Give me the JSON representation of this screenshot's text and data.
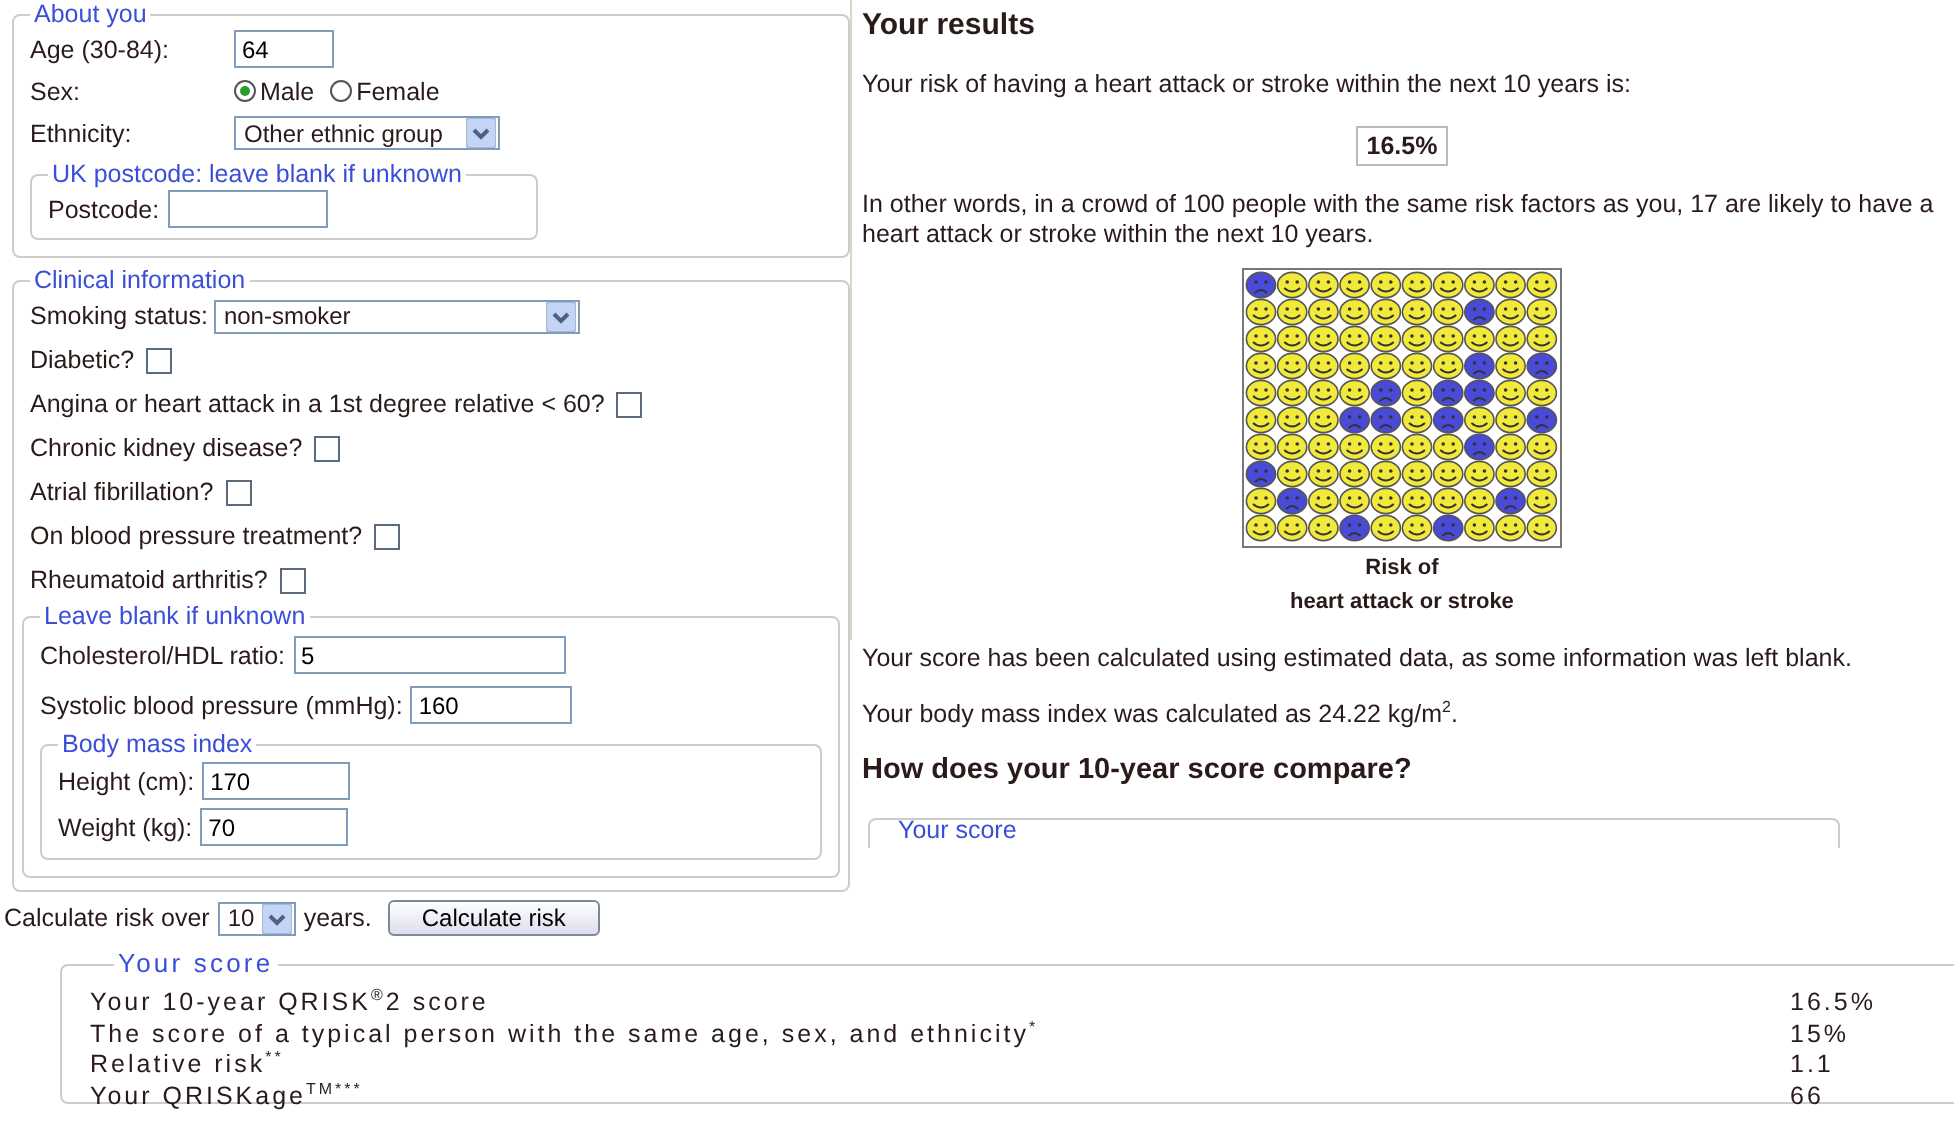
{
  "about": {
    "legend": "About you",
    "fields": [
      {
        "kind": "text",
        "label": "Age (30-84):",
        "value": "64"
      },
      {
        "kind": "radio",
        "label": "Sex:",
        "options": [
          {
            "label": "Male",
            "selected": true
          },
          {
            "label": "Female",
            "selected": false
          }
        ]
      },
      {
        "kind": "select",
        "label": "Ethnicity:",
        "value": "Other ethnic group"
      }
    ],
    "postcode": {
      "legend": "UK postcode: leave blank if unknown",
      "label": "Postcode:"
    }
  },
  "clinical": {
    "legend": "Clinical information",
    "smoking": {
      "label": "Smoking status:",
      "value": "non-smoker"
    },
    "checks": [
      {
        "label": "Diabetic?",
        "checked": false
      },
      {
        "label": "Angina or heart attack in a 1st degree relative < 60?",
        "checked": false
      },
      {
        "label": "Chronic kidney disease?",
        "checked": false
      },
      {
        "label": "Atrial fibrillation?",
        "checked": false
      },
      {
        "label": "On blood pressure treatment?",
        "checked": false
      },
      {
        "label": "Rheumatoid arthritis?",
        "checked": false
      }
    ],
    "optional": {
      "legend": "Leave blank if unknown",
      "fields": [
        {
          "label": "Cholesterol/HDL ratio:",
          "value": "5"
        },
        {
          "label": "Systolic blood pressure (mmHg):",
          "value": "160"
        }
      ],
      "bmi": {
        "legend": "Body mass index",
        "fields": [
          {
            "label": "Height (cm):",
            "value": "170"
          },
          {
            "label": "Weight (kg):",
            "value": "70"
          }
        ]
      }
    }
  },
  "calculate": {
    "label": "Calculate risk over",
    "value": "10",
    "suffix": "years.",
    "button": "Calculate risk"
  },
  "results": {
    "title": "Your results",
    "intro": "Your risk of having a heart attack or stroke within the next 10 years is:",
    "risk": "16.5%",
    "crowd_text": "In other words, in a crowd of 100 people with the same risk factors as you, 17 are likely to have a heart attack or stroke within the next 10 years.",
    "crowd": {
      "rows": [
        {
          "sad": [
            true,
            false,
            false,
            false,
            false,
            false,
            false,
            false,
            false,
            false
          ]
        },
        {
          "sad": [
            false,
            false,
            false,
            false,
            false,
            false,
            false,
            true,
            false,
            false
          ]
        },
        {
          "sad": [
            false,
            false,
            false,
            false,
            false,
            false,
            false,
            false,
            false,
            false
          ]
        },
        {
          "sad": [
            false,
            false,
            false,
            false,
            false,
            false,
            false,
            true,
            false,
            true
          ]
        },
        {
          "sad": [
            false,
            false,
            false,
            false,
            true,
            false,
            true,
            true,
            false,
            false
          ]
        },
        {
          "sad": [
            false,
            false,
            false,
            true,
            true,
            false,
            true,
            false,
            false,
            true
          ]
        },
        {
          "sad": [
            false,
            false,
            false,
            false,
            false,
            false,
            false,
            true,
            false,
            false
          ]
        },
        {
          "sad": [
            true,
            false,
            false,
            false,
            false,
            false,
            false,
            false,
            false,
            false
          ]
        },
        {
          "sad": [
            false,
            true,
            false,
            false,
            false,
            false,
            false,
            false,
            true,
            false
          ]
        },
        {
          "sad": [
            false,
            false,
            false,
            true,
            false,
            false,
            true,
            false,
            false,
            false
          ]
        }
      ],
      "caption": [
        "Risk of",
        "heart attack or stroke"
      ]
    },
    "notes": [
      "Your score has been calculated using estimated data, as some information was left blank.",
      "Your body mass index was calculated as 24.22 kg/m$^{2}$."
    ],
    "compare_title": "How does your 10-year score compare?",
    "score_legend": "Your score"
  },
  "score_table": {
    "legend": "Your score",
    "rows": [
      {
        "label": "Your 10-year QRISK$^{®}$2 score",
        "value": "16.5%"
      },
      {
        "label": "The score of a typical person with the same age, sex, and ethnicity$^{*}$",
        "value": "15%"
      },
      {
        "label": "Relative risk$^{**}$",
        "value": "1.1"
      },
      {
        "label": "Your QRISKage$^{TM***}$",
        "value": "66"
      }
    ]
  }
}
